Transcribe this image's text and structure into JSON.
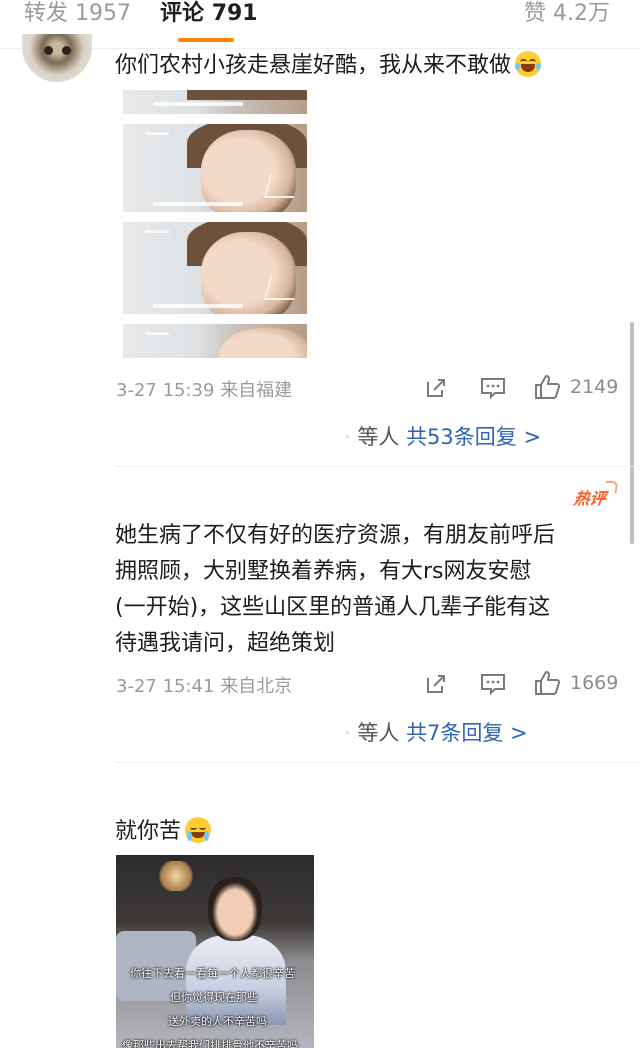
{
  "tabs": {
    "repost_label": "转发",
    "repost_count": "1957",
    "comment_label": "评论",
    "comment_count": "791",
    "like_label": "赞",
    "like_count": "4.2万"
  },
  "comments": [
    {
      "text": "你们农村小孩走悬崖好酷，我从来不敢做",
      "emoji": "laughing-tears-emoji",
      "timestamp": "3-27 15:39",
      "location": "来自福建",
      "likes": "2149",
      "reply_who": "等人",
      "reply_count": "共53条回复 >"
    },
    {
      "badge": "热评",
      "text_lines": [
        "她生病了不仅有好的医疗资源，有朋友前呼后",
        "拥照顾，大别墅换着养病，有大rs网友安慰",
        "(一开始)，这些山区里的普通人几辈子能有这",
        "待遇我请问，超绝策划"
      ],
      "timestamp": "3-27 15:41",
      "location": "来自北京",
      "likes": "1669",
      "reply_who": "等人",
      "reply_count": "共7条回复 >"
    },
    {
      "text": "就你苦",
      "emoji": "crying-emoji",
      "image_subtitles": [
        "你往下去看一看每一个人都很辛苦",
        "但你觉得现在那些",
        "送外卖的人不辛苦吗",
        "像那些出去帮我们排排骨他不辛苦吗"
      ]
    }
  ],
  "colors": {
    "accent": "#ff8200",
    "link": "#2f63b8",
    "hot": "#ff5a1f"
  }
}
